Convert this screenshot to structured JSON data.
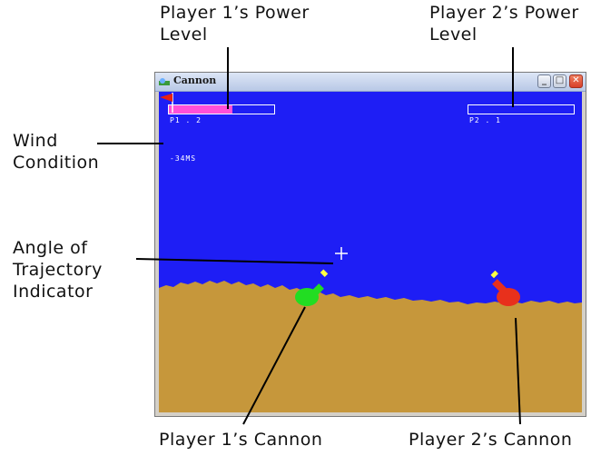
{
  "window": {
    "title": "Cannon",
    "minimize_glyph": "_",
    "maximize_glyph": "□",
    "close_glyph": "✕"
  },
  "hud": {
    "player1_label": "P1 . 2",
    "player2_label": "P2 . 1",
    "wind_speed": "-34MS",
    "player1_power": 0.6,
    "player2_power": 0.0
  },
  "annotations": {
    "p1_power": "Player 1’s Power\nLevel",
    "p2_power": "Player 2’s Power\nLevel",
    "wind": "Wind\nCondition",
    "angle": "Angle of\nTrajectory\nIndicator",
    "p1_cannon": "Player 1’s Cannon",
    "p2_cannon": "Player 2’s Cannon"
  },
  "colors": {
    "sky": "#1e1ef5",
    "ground": "#c6973b",
    "power_fill": "#ff4fd8",
    "p1_cannon": "#22dd22",
    "p2_cannon": "#e8301c",
    "flag": "#e82010"
  },
  "icons": [
    "app-icon",
    "minimize-icon",
    "maximize-icon",
    "close-icon",
    "wind-flag-icon",
    "crosshair-icon"
  ]
}
